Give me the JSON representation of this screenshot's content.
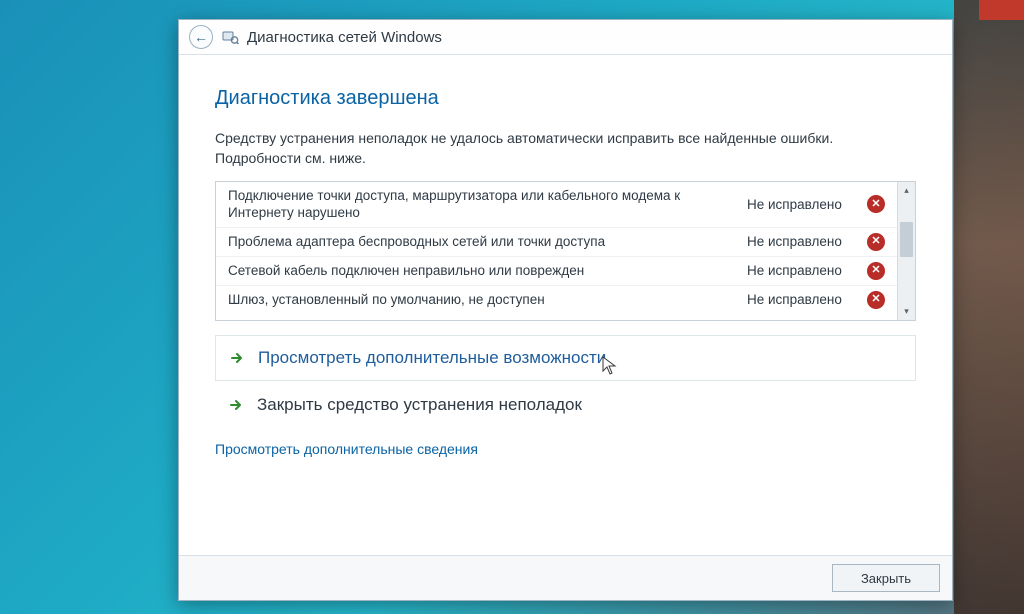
{
  "header": {
    "title": "Диагностика сетей Windows"
  },
  "main": {
    "heading": "Диагностика завершена",
    "subtext": "Средству устранения неполадок не удалось автоматически исправить все найденные ошибки. Подробности см. ниже."
  },
  "issues": [
    {
      "desc": "Подключение точки доступа, маршрутизатора или кабельного модема к Интернету нарушено",
      "status": "Не исправлено"
    },
    {
      "desc": "Проблема адаптера беспроводных сетей или точки доступа",
      "status": "Не исправлено"
    },
    {
      "desc": "Сетевой кабель подключен неправильно или поврежден",
      "status": "Не исправлено"
    },
    {
      "desc": "Шлюз, установленный по умолчанию, не доступен",
      "status": "Не исправлено"
    }
  ],
  "actions": {
    "more_options": "Просмотреть дополнительные возможности",
    "close_troubleshooter": "Закрыть средство устранения неполадок"
  },
  "details_link": "Просмотреть дополнительные сведения",
  "footer": {
    "close": "Закрыть"
  }
}
